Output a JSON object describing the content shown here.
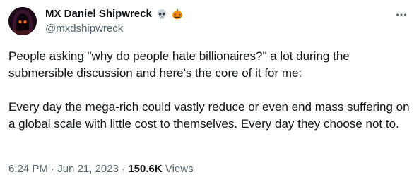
{
  "author": {
    "display_name": "MX Daniel Shipwreck",
    "handle": "@mxdshipwreck",
    "badges": [
      "skull-emoji",
      "jack-o-lantern-emoji"
    ],
    "avatar": "hooded-figure-avatar"
  },
  "tweet": {
    "paragraph_1": "People asking \"why do people hate billionaires?\" a lot during the submersible discussion and here's the core of it for me:",
    "paragraph_2": "Every day the mega-rich could vastly reduce or even end mass suffering on a global scale with little cost to themselves. Every day they choose not to."
  },
  "meta": {
    "time": "6:24 PM",
    "separator": " · ",
    "date": "Jun 21, 2023",
    "views_count": "150.6K",
    "views_label": " Views"
  },
  "actions": {
    "more_icon": "more-dots-icon"
  },
  "colors": {
    "text_primary": "#0f1419",
    "text_secondary": "#536471",
    "background": "#ffffff"
  }
}
